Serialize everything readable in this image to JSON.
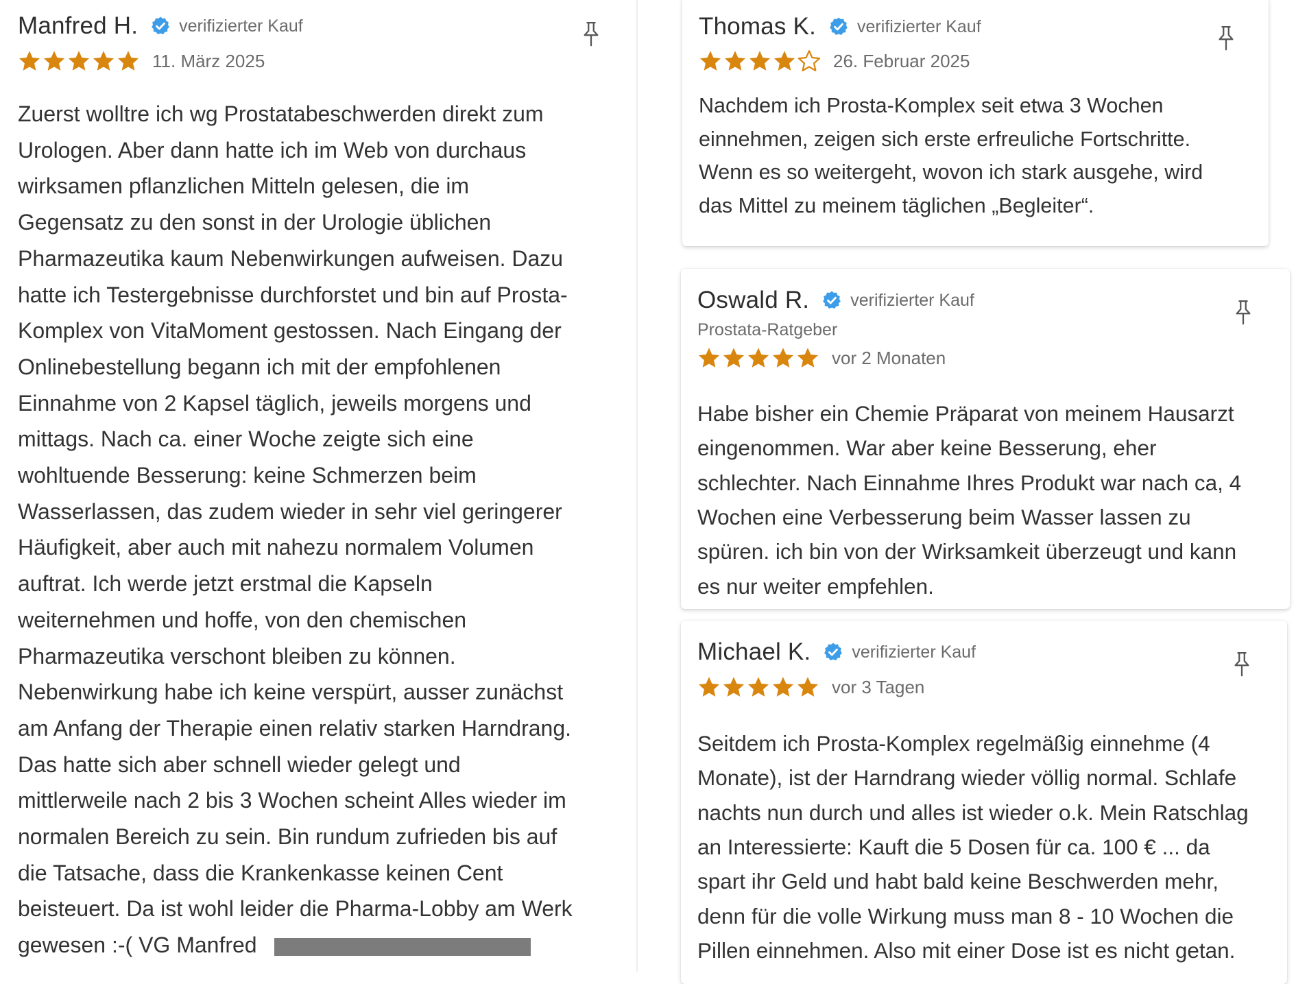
{
  "colors": {
    "star": "#d9860f",
    "verified_badge": "#3d9de8",
    "text": "#333333",
    "muted": "#6b6b6b"
  },
  "icons": {
    "verified": "verified-badge-icon",
    "pin": "pin-icon",
    "star": "star-icon"
  },
  "reviews": [
    {
      "name": "Manfred H.",
      "verified_label": "verifizierter Kauf",
      "rating": 5,
      "date": "11. März 2025",
      "lines": [
        "Zuerst wolltre ich wg Prostatabeschwerden direkt zum",
        "Urologen. Aber dann hatte ich im Web von durchaus",
        "wirksamen pflanzlichen Mitteln gelesen, die im",
        "Gegensatz zu den sonst in der Urologie üblichen",
        "Pharmazeutika kaum Nebenwirkungen aufweisen. Dazu",
        "hatte ich Testergebnisse durchforstet und bin auf Prosta-",
        "Komplex von VitaMoment gestossen. Nach Eingang der",
        "Onlinebestellung begann ich mit der empfohlenen",
        "Einnahme von 2 Kapsel täglich, jeweils morgens und",
        "mittags. Nach ca. einer Woche zeigte sich eine",
        "wohltuende Besserung: keine Schmerzen beim",
        "Wasserlassen, das zudem wieder in sehr viel geringerer",
        "Häufigkeit, aber auch mit nahezu normalem Volumen",
        "auftrat. Ich werde jetzt erstmal die Kapseln",
        "weiternehmen und hoffe, von den chemischen",
        "Pharmazeutika verschont bleiben zu können.",
        "Nebenwirkung habe ich keine verspürt, ausser zunächst",
        "am Anfang der Therapie einen relativ starken Harndrang.",
        "Das hatte sich aber schnell wieder gelegt und",
        "mittlerweile nach 2 bis 3 Wochen scheint Alles wieder im",
        "normalen Bereich zu sein. Bin rundum zufrieden bis auf",
        "die Tatsache, dass die Krankenkasse keinen Cent",
        "beisteuert. Da ist wohl leider die Pharma-Lobby am Werk",
        "gewesen :-( VG Manfred"
      ]
    },
    {
      "name": "Thomas K.",
      "verified_label": "verifizierter Kauf",
      "rating": 4,
      "date": "26. Februar 2025",
      "lines": [
        "Nachdem ich Prosta-Komplex seit etwa 3 Wochen",
        "einnehmen, zeigen sich erste erfreuliche Fortschritte.",
        "Wenn es so weitergeht, wovon ich stark ausgehe, wird",
        "das Mittel zu meinem täglichen „Begleiter“."
      ]
    },
    {
      "name": "Oswald R.",
      "verified_label": "verifizierter Kauf",
      "subtitle": "Prostata-Ratgeber",
      "rating": 5,
      "date": "vor 2 Monaten",
      "lines": [
        "Habe bisher ein Chemie Präparat von meinem Hausarzt",
        "eingenommen. War aber keine Besserung, eher",
        "schlechter. Nach Einnahme Ihres Produkt war nach ca, 4",
        "Wochen eine Verbesserung beim Wasser lassen zu",
        "spüren. ich bin von der Wirksamkeit überzeugt und kann",
        "es nur weiter empfehlen."
      ]
    },
    {
      "name": "Michael K.",
      "verified_label": "verifizierter Kauf",
      "rating": 5,
      "date": "vor 3 Tagen",
      "lines": [
        "Seitdem ich Prosta-Komplex regelmäßig einnehme (4",
        "Monate), ist der Harndrang wieder völlig normal. Schlafe",
        "nachts nun durch und alles ist wieder o.k. Mein Ratschlag",
        "an Interessierte: Kauft die 5 Dosen für ca. 100 € ... da",
        "spart ihr Geld und habt bald keine Beschwerden mehr,",
        "denn für die volle Wirkung muss man 8 - 10 Wochen die",
        "Pillen einnehmen. Also mit einer Dose ist es nicht getan."
      ]
    }
  ]
}
